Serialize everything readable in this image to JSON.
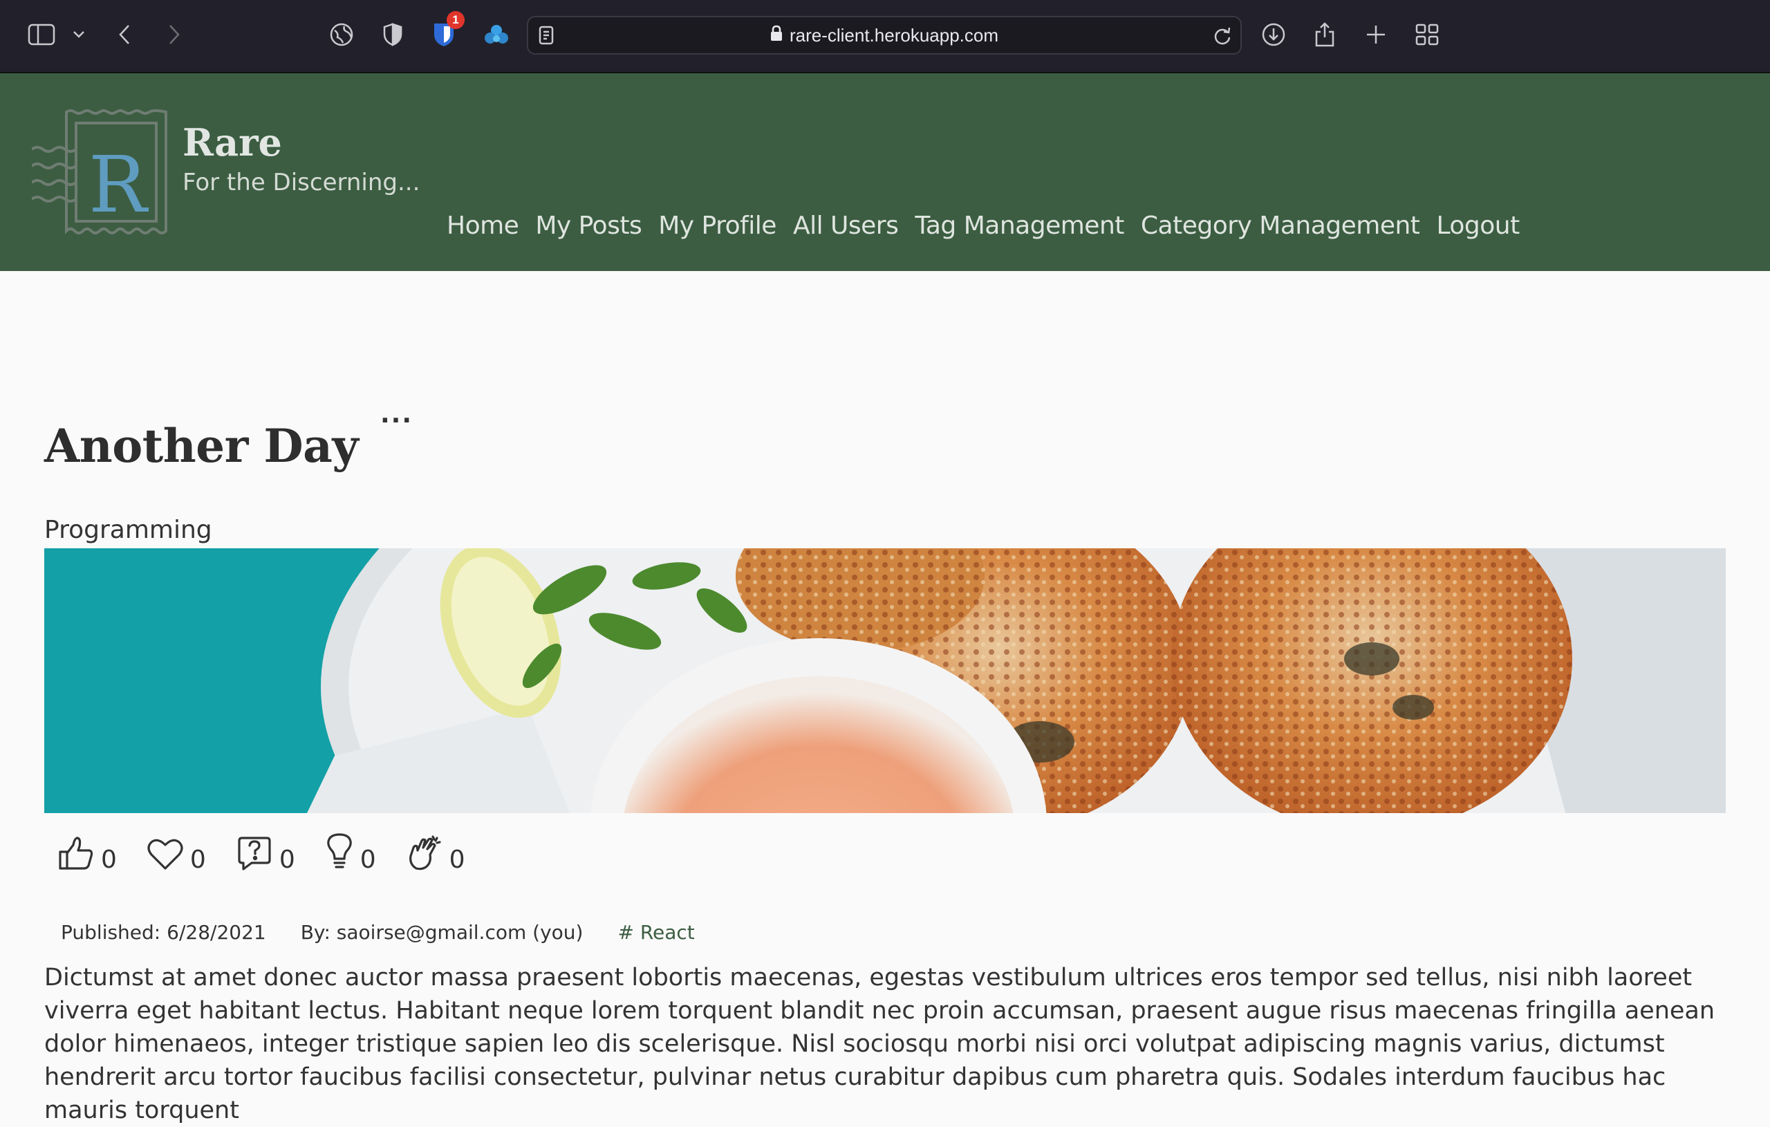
{
  "browser": {
    "url": "rare-client.herokuapp.com",
    "extension_badge_count": "1"
  },
  "site": {
    "logo_letter": "R",
    "title": "Rare",
    "tagline": "For the Discerning...",
    "nav": [
      {
        "label": "Home"
      },
      {
        "label": "My Posts"
      },
      {
        "label": "My Profile"
      },
      {
        "label": "All Users"
      },
      {
        "label": "Tag Management"
      },
      {
        "label": "Category Management"
      },
      {
        "label": "Logout"
      }
    ]
  },
  "post": {
    "menu_label": "...",
    "title": "Another Day",
    "category": "Programming",
    "reactions": [
      {
        "icon": "thumbs-up-icon",
        "count": "0"
      },
      {
        "icon": "heart-icon",
        "count": "0"
      },
      {
        "icon": "question-icon",
        "count": "0"
      },
      {
        "icon": "lightbulb-icon",
        "count": "0"
      },
      {
        "icon": "clapping-hands-icon",
        "count": "0"
      }
    ],
    "published": "Published: 6/28/2021",
    "author": "By: saoirse@gmail.com (you)",
    "tag": "# React",
    "body": "Dictumst at amet donec auctor massa praesent lobortis maecenas, egestas vestibulum ultrices eros tempor sed tellus, nisi nibh laoreet viverra eget habitant lectus. Habitant neque lorem torquent blandit nec proin accumsan, praesent augue risus maecenas fringilla aenean dolor himenaeos, integer tristique sapien leo dis scelerisque. Nisl sociosqu morbi nisi orci volutpat adipiscing magnis varius, dictumst hendrerit arcu tortor faucibus facilisi consectetur, pulvinar netus curabitur dapibus cum pharetra quis. Sodales interdum faucibus hac mauris torquent"
  },
  "colors": {
    "chrome": "#22212b",
    "header_green": "#3c5d42",
    "page_bg": "#fafafa",
    "tag_green": "#3c5d42"
  }
}
